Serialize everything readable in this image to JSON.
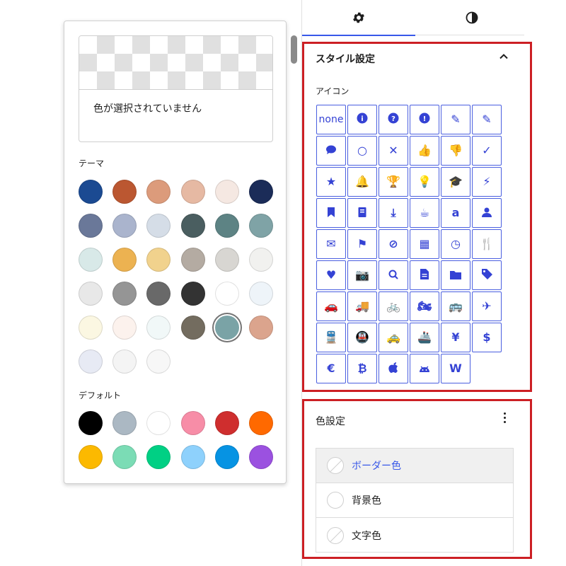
{
  "picker": {
    "preview_text": "色が選択されていません",
    "theme_title": "テーマ",
    "default_title": "デフォルト",
    "theme_colors": [
      "#1b4a92",
      "#bb5731",
      "#dc9b7b",
      "#e6b9a3",
      "#f5e8e2",
      "#1b2c58",
      "#6a7899",
      "#aab4cd",
      "#d5dde7",
      "#4a5e60",
      "#5d8384",
      "#7fa3a6",
      "#d8e9e8",
      "#ecb251",
      "#f1d28d",
      "#b4aba2",
      "#d8d6d2",
      "#f1f1ef",
      "#e8e8e8",
      "#959595",
      "#696969",
      "#333333",
      "#ffffff",
      "#eef4f9",
      "#fbf7e2",
      "#fcf2ed",
      "#f1f8f8",
      "#736c5f",
      "#7aa3a6",
      "#dba48d",
      "#e7eaf4",
      "#f4f4f4",
      "#f7f7f7"
    ],
    "selected_theme_index": 28,
    "default_colors": [
      "#000000",
      "#abb8c3",
      "#ffffff",
      "#f78da7",
      "#cf2e2e",
      "#ff6900",
      "#fcb900",
      "#7bdcb5",
      "#00d084",
      "#8ed1fc",
      "#0693e3",
      "#9b51e0"
    ]
  },
  "tabs": [
    {
      "icon": "gear-icon",
      "active": true
    },
    {
      "icon": "half-circle-icon",
      "active": false
    }
  ],
  "style_section": {
    "title": "スタイル設定",
    "icon_label": "アイコン",
    "icons": [
      {
        "name": "none-option",
        "text": "none"
      },
      {
        "name": "info-circle-icon",
        "glyph": "i"
      },
      {
        "name": "question-circle-icon",
        "glyph": "?"
      },
      {
        "name": "exclamation-circle-icon",
        "glyph": "!"
      },
      {
        "name": "pencil-icon",
        "glyph": "✎"
      },
      {
        "name": "edit-box-icon",
        "glyph": "✎"
      },
      {
        "name": "comment-icon",
        "glyph": ""
      },
      {
        "name": "circle-icon",
        "glyph": "○"
      },
      {
        "name": "times-icon",
        "glyph": "✕"
      },
      {
        "name": "thumbs-up-icon",
        "glyph": "👍"
      },
      {
        "name": "thumbs-down-icon",
        "glyph": "👎"
      },
      {
        "name": "check-icon",
        "glyph": "✓"
      },
      {
        "name": "star-icon",
        "glyph": "★"
      },
      {
        "name": "bell-icon",
        "glyph": "🔔"
      },
      {
        "name": "trophy-icon",
        "glyph": "🏆"
      },
      {
        "name": "lightbulb-icon",
        "glyph": "💡"
      },
      {
        "name": "graduation-cap-icon",
        "glyph": "🎓"
      },
      {
        "name": "bolt-icon",
        "glyph": "⚡"
      },
      {
        "name": "bookmark-icon",
        "glyph": ""
      },
      {
        "name": "book-icon",
        "glyph": ""
      },
      {
        "name": "download-icon",
        "glyph": "⤓"
      },
      {
        "name": "coffee-icon",
        "glyph": "☕"
      },
      {
        "name": "amazon-icon",
        "glyph": "a"
      },
      {
        "name": "user-icon",
        "glyph": ""
      },
      {
        "name": "envelope-icon",
        "glyph": "✉"
      },
      {
        "name": "flag-icon",
        "glyph": "⚑"
      },
      {
        "name": "ban-icon",
        "glyph": "⊘"
      },
      {
        "name": "calendar-icon",
        "glyph": "▦"
      },
      {
        "name": "clock-icon",
        "glyph": "◷"
      },
      {
        "name": "utensils-icon",
        "glyph": "🍴"
      },
      {
        "name": "heart-icon",
        "glyph": "♥"
      },
      {
        "name": "camera-icon",
        "glyph": "📷"
      },
      {
        "name": "search-icon",
        "glyph": ""
      },
      {
        "name": "file-icon",
        "glyph": ""
      },
      {
        "name": "folder-icon",
        "glyph": ""
      },
      {
        "name": "tag-icon",
        "glyph": ""
      },
      {
        "name": "car-icon",
        "glyph": "🚗"
      },
      {
        "name": "truck-icon",
        "glyph": "🚚"
      },
      {
        "name": "bicycle-icon",
        "glyph": "🚲"
      },
      {
        "name": "motorcycle-icon",
        "glyph": "🏍"
      },
      {
        "name": "bus-icon",
        "glyph": "🚌"
      },
      {
        "name": "plane-icon",
        "glyph": "✈"
      },
      {
        "name": "train-icon",
        "glyph": "🚆"
      },
      {
        "name": "subway-icon",
        "glyph": "🚇"
      },
      {
        "name": "taxi-icon",
        "glyph": "🚕"
      },
      {
        "name": "ship-icon",
        "glyph": "🚢"
      },
      {
        "name": "yen-icon",
        "glyph": "¥"
      },
      {
        "name": "dollar-icon",
        "glyph": "$"
      },
      {
        "name": "euro-icon",
        "glyph": "€"
      },
      {
        "name": "bitcoin-icon",
        "glyph": "₿"
      },
      {
        "name": "apple-icon",
        "glyph": ""
      },
      {
        "name": "android-icon",
        "glyph": ""
      },
      {
        "name": "wordpress-icon",
        "glyph": "W"
      }
    ]
  },
  "color_section": {
    "title": "色設定",
    "items": [
      {
        "label": "ボーダー色",
        "slash": true,
        "active": true
      },
      {
        "label": "背景色",
        "slash": false,
        "active": false
      },
      {
        "label": "文字色",
        "slash": true,
        "active": false
      }
    ]
  }
}
